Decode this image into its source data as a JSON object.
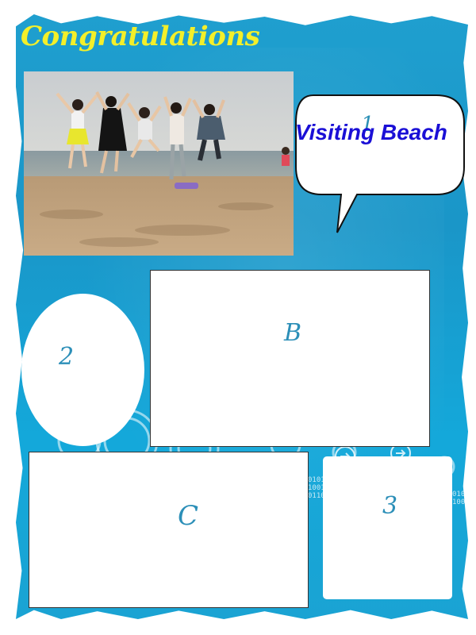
{
  "poster": {
    "title": "Congratulations",
    "photo_alt": "Friends jumping on the beach",
    "bubble": {
      "number": "1",
      "caption": "Visiting Beach"
    },
    "placeholders": {
      "b": "B",
      "c": "C",
      "two": "2",
      "three": "3"
    },
    "binary_text": [
      "0101",
      "1001",
      "0110"
    ]
  },
  "colors": {
    "background": "#1a96c8",
    "title": "#f3ef2a",
    "caption": "#1a0fd6",
    "placeholder_label": "#2c8fb8"
  },
  "icons": [
    "arrow-circle-icon",
    "arrow-circle-icon"
  ]
}
